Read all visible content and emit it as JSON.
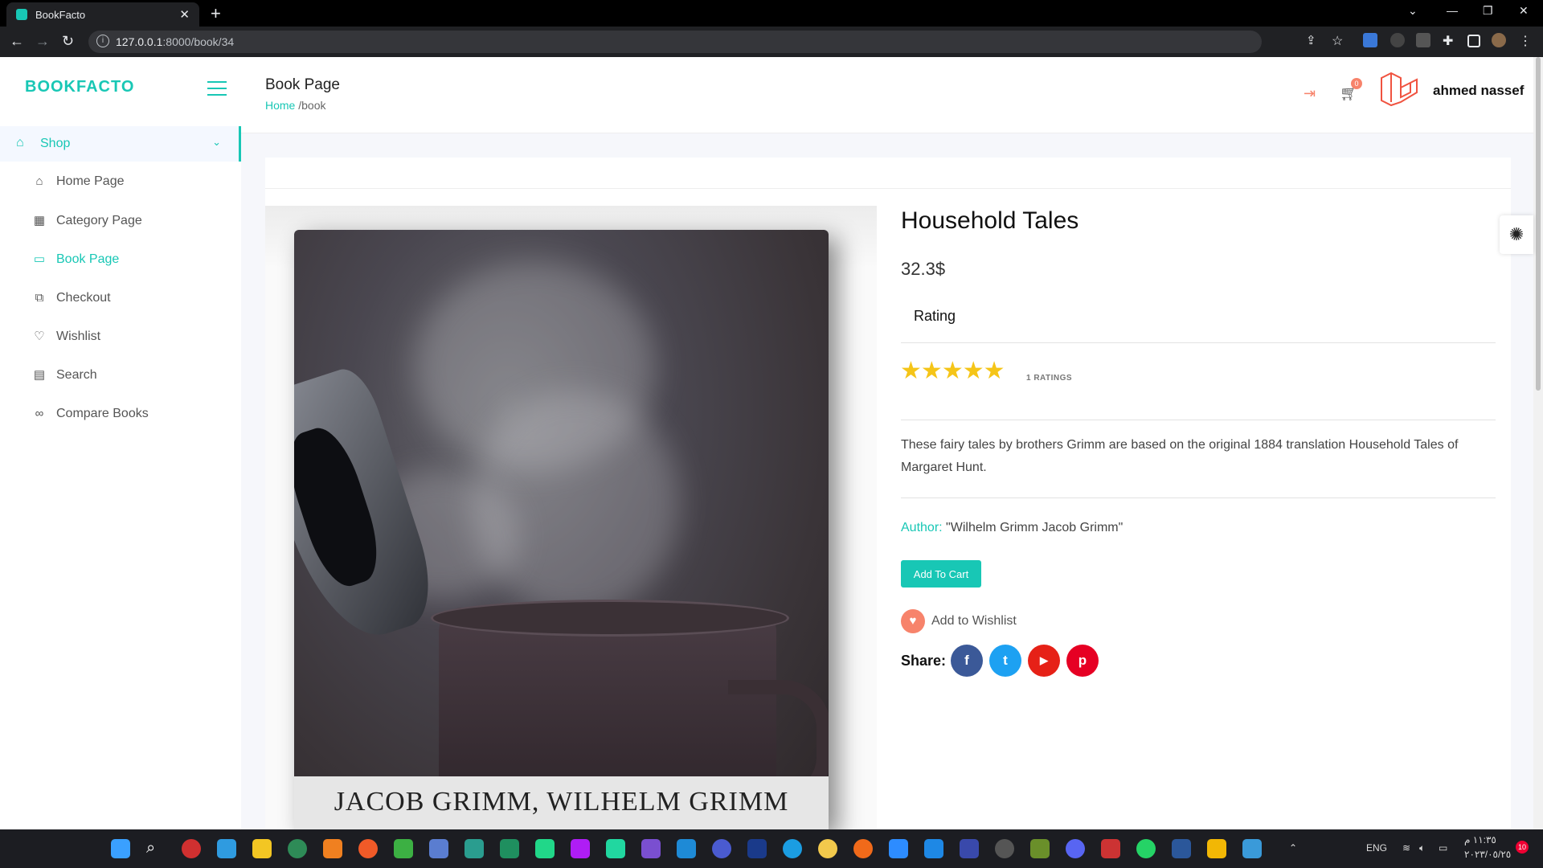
{
  "browser": {
    "tab_title": "BookFacto",
    "tab_close": "✕",
    "new_tab": "+",
    "url_host": "127.0.0.1",
    "url_path": ":8000/book/34"
  },
  "sidebar": {
    "logo": "BOOKFACTO",
    "section": "Shop",
    "items": [
      {
        "label": "Home Page",
        "icon": "home-icon"
      },
      {
        "label": "Category Page",
        "icon": "grid-icon"
      },
      {
        "label": "Book Page",
        "icon": "book-icon",
        "active": true
      },
      {
        "label": "Checkout",
        "icon": "copy-icon"
      },
      {
        "label": "Wishlist",
        "icon": "heart-icon"
      },
      {
        "label": "Search",
        "icon": "document-icon"
      },
      {
        "label": "Compare Books",
        "icon": "compare-icon"
      }
    ]
  },
  "header": {
    "title": "Book Page",
    "breadcrumb_home": "Home",
    "breadcrumb_current": "/book",
    "cart_count": "0",
    "user_name": "ahmed nassef"
  },
  "book": {
    "title": "Household Tales",
    "price": "32.3$",
    "rating_heading": "Rating",
    "stars": 5,
    "ratings_count": "1 RATINGS",
    "description": "These fairy tales by brothers Grimm are based on the original 1884 translation Household Tales of Margaret Hunt.",
    "author_label": "Author:",
    "author_value": "\"Wilhelm Grimm Jacob Grimm\"",
    "cover_author_text": "JACOB GRIMM, WILHELM GRIMM",
    "add_to_cart": "Add To Cart",
    "add_to_wishlist": "Add to Wishlist",
    "share_label": "Share:"
  },
  "social": [
    {
      "name": "facebook",
      "glyph": "f",
      "color": "#3b5998"
    },
    {
      "name": "twitter",
      "glyph": "t",
      "color": "#1da1f2"
    },
    {
      "name": "youtube",
      "glyph": "▶",
      "color": "#e62117"
    },
    {
      "name": "pinterest",
      "glyph": "p",
      "color": "#e60023"
    }
  ],
  "colors": {
    "accent": "#18c7b5",
    "heart": "#f7836b",
    "star": "#f5c518"
  },
  "taskbar": {
    "language": "ENG",
    "time": "١١:٣٥ م",
    "date": "٢٠٢٣/٠٥/٢٥",
    "notif_count": "10"
  }
}
